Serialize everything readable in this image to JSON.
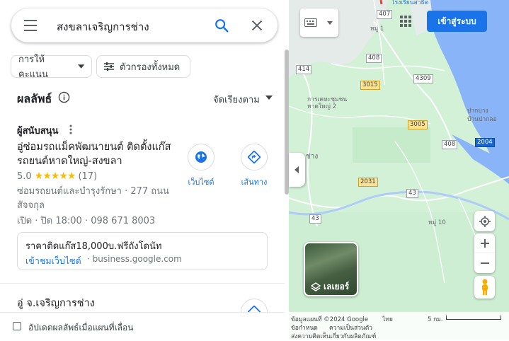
{
  "search": {
    "query": "สงขลาเจริญการช่าง"
  },
  "filters": {
    "rating_chip": "การให้คะแนน",
    "all_filters_chip": "ตัวกรองทั้งหมด"
  },
  "results": {
    "title": "ผลลัพธ์",
    "sort_label": "จัดเรียงตาม",
    "sponsored_label": "ผู้สนับสนุน",
    "first": {
      "name": "อู่ซ่อมรถแม็คพัฒนายนต์ ติดตั้งแก๊สรถยนต์หาดใหญ่-สงขลา",
      "rating": "5.0",
      "stars": "★★★★★",
      "review_count": "(17)",
      "category_address": "ซ่อมรถยนต์และบำรุงรักษา · 277 ถนน สัจจกุล",
      "hours_phone": "เปิด · ปิด 18:00 · 098 671 8003",
      "website_label": "เว็บไซต์",
      "directions_label": "เส้นทาง",
      "promo_text": "ราคาติดแก๊ส18,000บ.ฟรีถังโดนัท",
      "promo_link": "เข้าชมเว็บไซต์",
      "promo_domain": "business.google.com"
    },
    "second": {
      "name": "อู่ จ.เจริญการช่าง"
    }
  },
  "bottom": {
    "update_label": "อัปเดตผลลัพธ์เมื่อแผนที่เลื่อน"
  },
  "map": {
    "signin_label": "เข้าสู่ระบบ",
    "layer_label": "เลเยอร์",
    "labels": {
      "top_place": "โรงเรียนสาธิต",
      "village_1": "หมู่ 1",
      "district": "การเคหะชุมชน\nหาดใหญ่ 2",
      "pak_nang": "ปากบาง\nบ้านปากลอ",
      "chang": "ช่าง",
      "village_10": "หมู่ 10"
    },
    "route_shields": [
      "407",
      "408",
      "414",
      "4309",
      "3015",
      "3005",
      "408",
      "2004",
      "2031",
      "43",
      "43"
    ],
    "footer": {
      "data_line": "ข้อมูลแผนที่ ©2024 Google",
      "lang": "ไทย",
      "terms": "ข้อกำหนด",
      "privacy": "ความเป็นส่วนตัว",
      "feedback": "ส่งความคิดเห็นเกี่ยวกับผลิตภัณฑ์",
      "scale": "5 กม."
    }
  },
  "colors": {
    "accent": "#1a73e8",
    "star": "#fbbc04",
    "map_land": "#d3f1d7",
    "sea": "#8ab4f8"
  }
}
